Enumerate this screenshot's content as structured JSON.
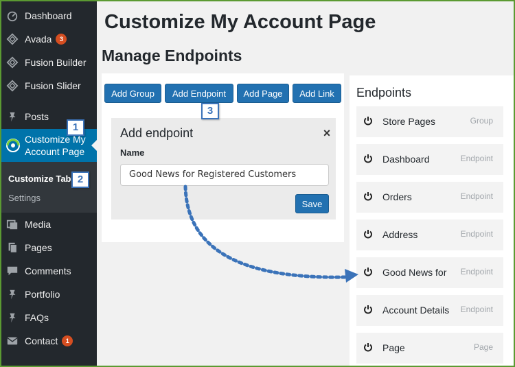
{
  "sidebar": {
    "items": [
      {
        "label": "Dashboard",
        "icon": "dashboard-icon"
      },
      {
        "label": "Avada",
        "badge": "3",
        "icon": "avada-icon"
      },
      {
        "label": "Fusion Builder",
        "icon": "fusion-builder-icon"
      },
      {
        "label": "Fusion Slider",
        "icon": "fusion-slider-icon"
      },
      {
        "label": "Posts",
        "icon": "pin-icon"
      },
      {
        "label": "Customize My Account Page",
        "icon": "customize-icon"
      },
      {
        "label": "Media",
        "icon": "media-icon"
      },
      {
        "label": "Pages",
        "icon": "pages-icon"
      },
      {
        "label": "Comments",
        "icon": "comments-icon"
      },
      {
        "label": "Portfolio",
        "icon": "pin-icon"
      },
      {
        "label": "FAQs",
        "icon": "pin-icon"
      },
      {
        "label": "Contact",
        "badge": "1",
        "icon": "mail-icon"
      }
    ],
    "submenu": [
      {
        "label": "Customize Tabs",
        "current": true
      },
      {
        "label": "Settings",
        "current": false
      }
    ]
  },
  "steps": [
    "1",
    "2",
    "3"
  ],
  "page_title": "Customize My Account Page",
  "section_title": "Manage Endpoints",
  "toolbar": {
    "add_group": "Add Group",
    "add_endpoint": "Add Endpoint",
    "add_page": "Add Page",
    "add_link": "Add Link"
  },
  "dialog": {
    "title": "Add endpoint",
    "close": "×",
    "field_label": "Name",
    "field_value": "Good News for Registered Customers",
    "save_label": "Save"
  },
  "endpoints": {
    "heading": "Endpoints",
    "items": [
      {
        "name": "Store Pages",
        "type": "Group"
      },
      {
        "name": "Dashboard",
        "type": "Endpoint"
      },
      {
        "name": "Orders",
        "type": "Endpoint"
      },
      {
        "name": "Address",
        "type": "Endpoint"
      },
      {
        "name": "Good News for",
        "type": "Endpoint"
      },
      {
        "name": "Account Details",
        "type": "Endpoint"
      },
      {
        "name": "Page",
        "type": "Page"
      }
    ]
  },
  "colors": {
    "sidebar_bg": "#23282d",
    "active_bg": "#0073aa",
    "button_bg": "#2271b1",
    "badge_bg": "#d54e21",
    "step_border": "#3b73b9"
  }
}
